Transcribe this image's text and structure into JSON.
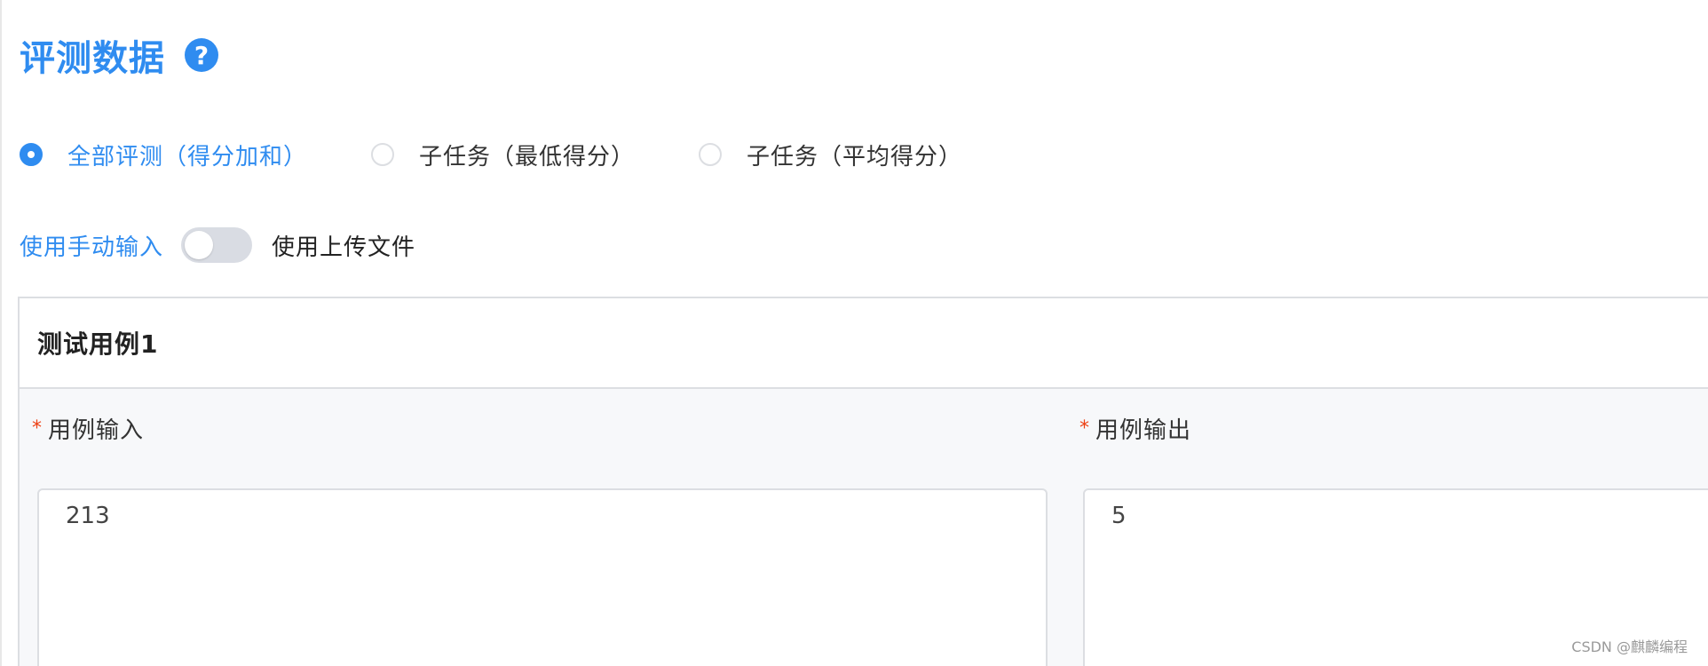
{
  "section": {
    "title": "评测数据",
    "help_icon_glyph": "?"
  },
  "colors": {
    "accent": "#2f8cf0",
    "required": "#ed4014"
  },
  "judge_mode": {
    "options": [
      {
        "label": "全部评测（得分加和）",
        "checked": true
      },
      {
        "label": "子任务（最低得分）",
        "checked": false
      },
      {
        "label": "子任务（平均得分）",
        "checked": false
      }
    ]
  },
  "input_mode": {
    "left_label": "使用手动输入",
    "right_label": "使用上传文件",
    "switch_on": false
  },
  "test_case": {
    "title": "测试用例1",
    "required_mark": "*",
    "input_label": "用例输入",
    "input_value": "213",
    "output_label": "用例输出",
    "output_value": "5"
  },
  "watermark": "CSDN @麒麟编程"
}
